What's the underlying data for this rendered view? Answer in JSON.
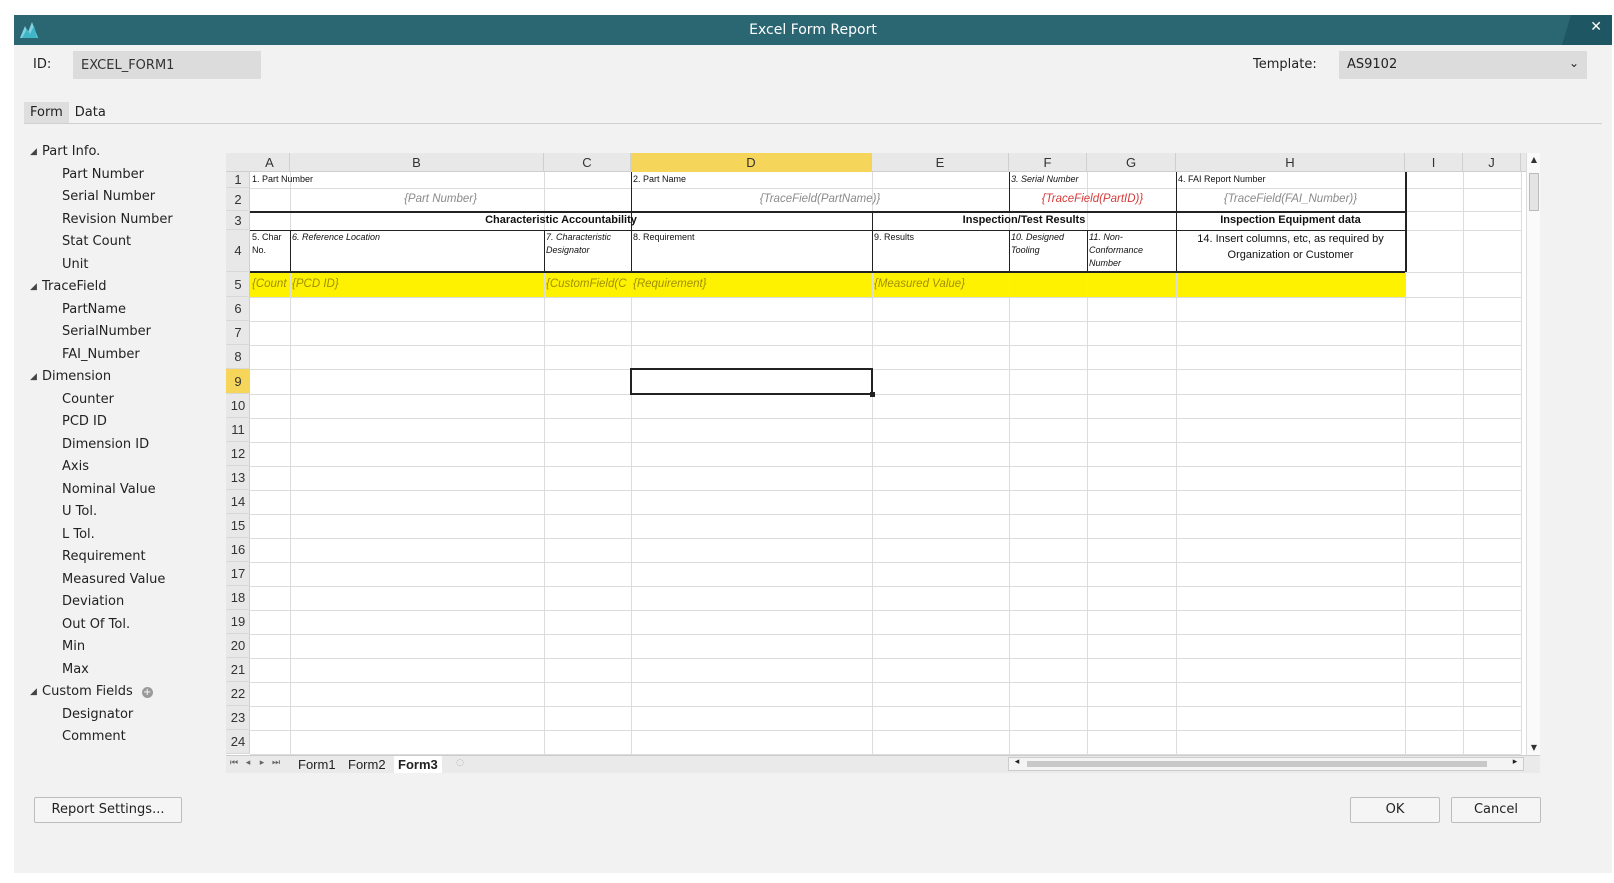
{
  "window": {
    "title": "Excel Form Report",
    "close_glyph": "✕"
  },
  "form": {
    "id_label": "ID:",
    "id_value": "EXCEL_FORM1",
    "template_label": "Template:",
    "template_value": "AS9102"
  },
  "tabs": [
    {
      "label": "Form",
      "active": true
    },
    {
      "label": "Data",
      "active": false
    }
  ],
  "tree": [
    {
      "label": "Part Info.",
      "children": [
        "Part Number",
        "Serial Number",
        "Revision Number",
        "Stat Count",
        "Unit"
      ]
    },
    {
      "label": "TraceField",
      "children": [
        "PartName",
        "SerialNumber",
        "FAI_Number"
      ]
    },
    {
      "label": "Dimension",
      "children": [
        "Counter",
        "PCD ID",
        "Dimension ID",
        "Axis",
        "Nominal Value",
        "U Tol.",
        "L Tol.",
        "Requirement",
        "Measured Value",
        "Deviation",
        "Out Of Tol.",
        "Min",
        "Max"
      ]
    },
    {
      "label": "Custom Fields",
      "children": [
        "Designator",
        "Comment"
      ],
      "has_add": true
    }
  ],
  "sheet": {
    "columns": [
      "A",
      "B",
      "C",
      "D",
      "E",
      "F",
      "G",
      "H",
      "I",
      "J"
    ],
    "selected_column": "D",
    "rows": [
      "1",
      "2",
      "3",
      "4",
      "5",
      "6",
      "7",
      "8",
      "9",
      "10",
      "11",
      "12",
      "13",
      "14",
      "15",
      "16",
      "17",
      "18",
      "19",
      "20",
      "21",
      "22",
      "23",
      "24"
    ],
    "selected_row": "9",
    "cells": {
      "a1": "1. Part Number",
      "d1": "2. Part Name",
      "f1": "3. Serial Number",
      "h1": "4. FAI Report Number",
      "b2": "{Part Number}",
      "d2": "{TraceField(PartName)}",
      "f2": "{TraceField(PartID)}",
      "h2": "{TraceField(FAI_Number)}",
      "a3": "Characteristic Accountability",
      "e3": "Inspection/Test Results",
      "h3": "Inspection Equipment data",
      "a4": "5. Char No.",
      "b4": "6. Reference Location",
      "c4": "7. Characteristic Designator",
      "d4": "8. Requirement",
      "e4": "9. Results",
      "f4": "10. Designed Tooling",
      "g4": "11. Non-Conformance Number",
      "h4": "14. Insert columns, etc, as required by Organization or Customer",
      "a5": "{Count",
      "b5": "{PCD ID}",
      "c5": "{CustomField(C",
      "d5": "{Requirement}",
      "e5": "{Measured Value}"
    },
    "sheet_tabs": [
      "Form1",
      "Form2",
      "Form3"
    ],
    "active_sheet": "Form3"
  },
  "buttons": {
    "report_settings": "Report Settings...",
    "ok": "OK",
    "cancel": "Cancel"
  },
  "colors": {
    "titlebar": "#2b6673",
    "selection_header": "#f6d65a",
    "highlight_row": "#fff200",
    "trace_red": "#d83a3a"
  }
}
